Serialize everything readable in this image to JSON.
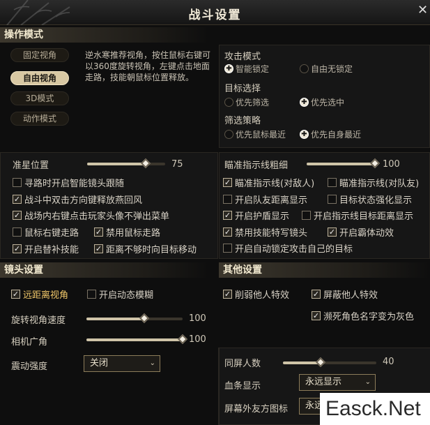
{
  "title": "战斗设置",
  "close_symbol": "✕",
  "operation": {
    "header": "操作模式",
    "modes": [
      "固定视角",
      "自由视角",
      "3D模式",
      "动作模式"
    ],
    "active_mode": "自由视角",
    "description": "逆水寒推荐视角，按住鼠标右键可以360度旋转视角，左键点击地面走路，技能朝鼠标位置释放。",
    "attack_mode": {
      "label": "攻击模式",
      "options": [
        "智能锁定",
        "自由无锁定"
      ],
      "selected": "智能锁定"
    },
    "target_select": {
      "label": "目标选择",
      "options": [
        "优先筛选",
        "优先选中"
      ],
      "selected": "优先选中"
    },
    "filter_strategy": {
      "label": "筛选策略",
      "options": [
        "优先鼠标最近",
        "优先自身最近"
      ],
      "selected": "优先自身最近"
    }
  },
  "crosshair": {
    "label": "准星位置",
    "value": 75,
    "max": 100
  },
  "aim_line": {
    "label": "瞄准指示线粗细",
    "value": 100,
    "max": 100
  },
  "left_checks": [
    {
      "label": "寻路时开启智能镜头跟随",
      "checked": false
    },
    {
      "label": "战斗中双击方向键释放燕回风",
      "checked": true
    },
    {
      "label": "战场内右键点击玩家头像不弹出菜单",
      "checked": true
    }
  ],
  "left_pair_checks": [
    [
      {
        "label": "鼠标右键走路",
        "checked": false
      },
      {
        "label": "禁用鼠标走路",
        "checked": true
      }
    ],
    [
      {
        "label": "开启替补技能",
        "checked": true
      },
      {
        "label": "距离不够时向目标移动",
        "checked": true
      }
    ]
  ],
  "right_checks": [
    [
      {
        "label": "瞄准指示线(对敌人)",
        "checked": true
      },
      {
        "label": "瞄准指示线(对队友)",
        "checked": false
      }
    ],
    [
      {
        "label": "开启队友距离显示",
        "checked": false
      },
      {
        "label": "目标状态强化显示",
        "checked": false
      }
    ],
    [
      {
        "label": "开启护盾显示",
        "checked": true
      },
      {
        "label": "开启指示线目标距离显示",
        "checked": false
      }
    ],
    [
      {
        "label": "禁用技能特写镜头",
        "checked": true
      },
      {
        "label": "开启霸体动效",
        "checked": true
      }
    ]
  ],
  "right_single_check": {
    "label": "开启自动锁定攻击自己的目标",
    "checked": false
  },
  "camera": {
    "header": "镜头设置",
    "far_view": {
      "label": "远距离视角",
      "checked": true
    },
    "dynamic_blur": {
      "label": "开启动态模糊",
      "checked": false
    },
    "rotate_speed": {
      "label": "旋转视角速度",
      "value": 100,
      "max": 100
    },
    "fov": {
      "label": "相机广角",
      "value": 100,
      "max": 100
    },
    "shake": {
      "label": "震动强度",
      "value": "关闭"
    }
  },
  "other": {
    "header": "其他设置",
    "weaken": {
      "label": "削弱他人特效",
      "checked": true
    },
    "hide_effects": {
      "label": "屏蔽他人特效",
      "checked": true
    },
    "dying_gray": {
      "label": "濒死角色名字变为灰色",
      "checked": true
    },
    "same_screen": {
      "label": "同屏人数",
      "value": 40,
      "max": 100
    },
    "hp_bar": {
      "label": "血条显示",
      "value": "永远显示"
    },
    "offscreen_icon": {
      "label": "屏幕外友方图标",
      "value": "永远显示"
    }
  },
  "watermark": "Easck.Net",
  "colors": {
    "highlight": "#f0c769",
    "accent": "#d8c8a3"
  }
}
